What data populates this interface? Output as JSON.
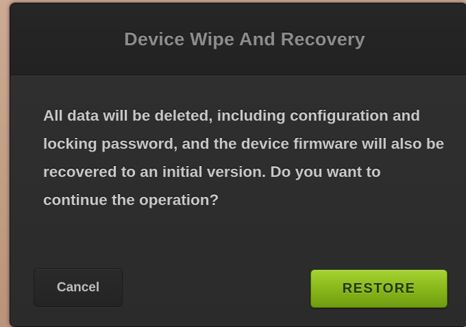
{
  "dialog": {
    "title": "Device Wipe And Recovery",
    "message": "All data will be deleted, including configuration and locking password, and the device firmware will also be recovered to an initial version. Do you want to continue the operation?",
    "cancel_label": "Cancel",
    "restore_label": "RESTORE"
  },
  "colors": {
    "dialog_background": "#2b2b2b",
    "title_text": "#8d8d8d",
    "message_text": "#c8c8c8",
    "restore_button": "#86b51a",
    "restore_text": "#243800"
  }
}
